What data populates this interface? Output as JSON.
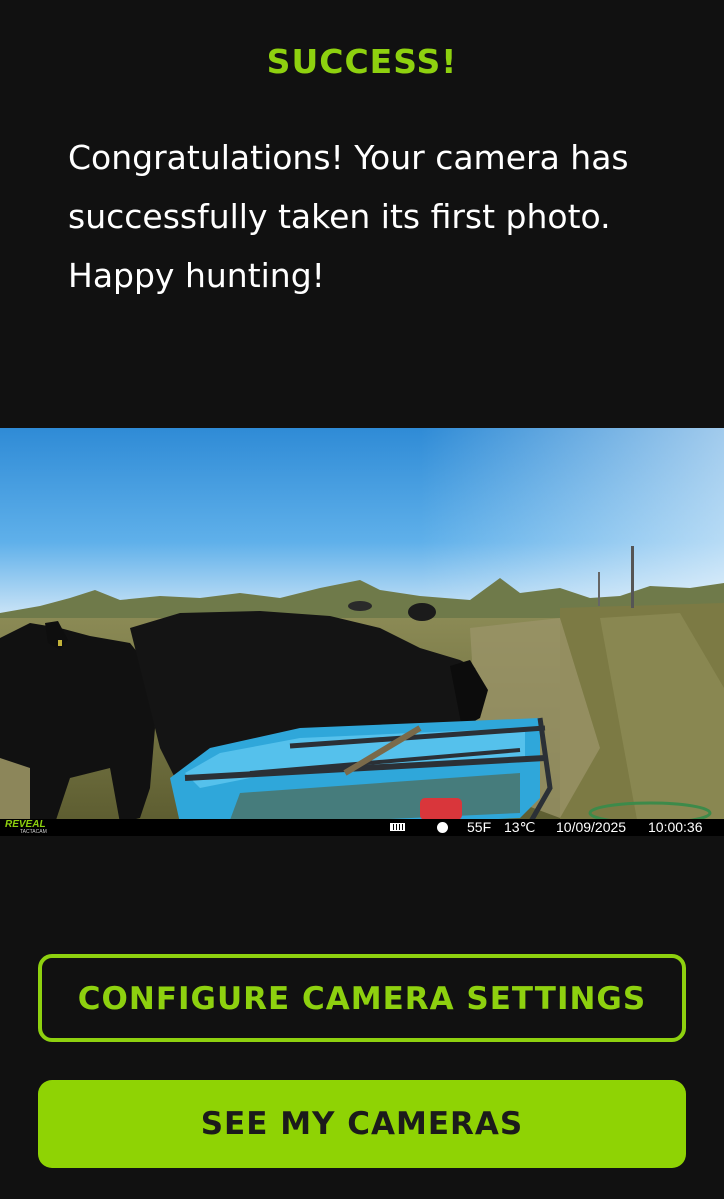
{
  "header": {
    "title": "SUCCESS!"
  },
  "message": {
    "text": "Congratulations! Your camera has successfully taken its first photo. Happy hunting!"
  },
  "photo": {
    "brand": "REVEAL",
    "brand_sub": "TACTACAM",
    "temp_f": "55F",
    "temp_c": "13℃",
    "date": "10/09/2025",
    "time": "10:00:36"
  },
  "actions": {
    "configure_label": "CONFIGURE CAMERA SETTINGS",
    "see_cameras_label": "SEE MY CAMERAS"
  },
  "colors": {
    "accent": "#8ed10f",
    "background": "#111111",
    "primary_button": "#8fd304"
  }
}
